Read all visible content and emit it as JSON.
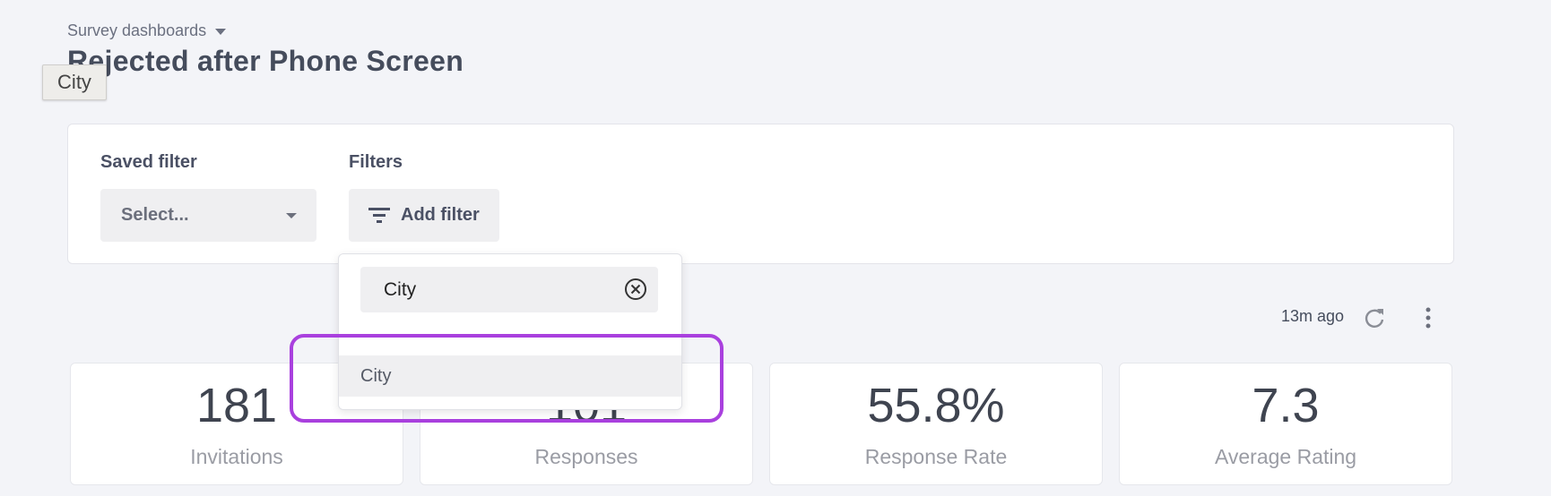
{
  "header": {
    "breadcrumb": "Survey dashboards",
    "title": "Rejected after Phone Screen"
  },
  "tooltip": {
    "text": "City"
  },
  "filters": {
    "saved_filter_label": "Saved filter",
    "saved_filter_value": "Select...",
    "filters_label": "Filters",
    "add_filter_label": "Add filter"
  },
  "dropdown": {
    "search_value": "City",
    "options": [
      {
        "label": "City"
      }
    ]
  },
  "status": {
    "updated": "13m ago"
  },
  "metrics": [
    {
      "value": "181",
      "label": "Invitations"
    },
    {
      "value": "101",
      "label": "Responses"
    },
    {
      "value": "55.8%",
      "label": "Response Rate"
    },
    {
      "value": "7.3",
      "label": "Average Rating"
    }
  ],
  "colors": {
    "background": "#f3f4f8",
    "highlight": "#a940de",
    "text_dark": "#454c5c",
    "text_muted": "#9a9ca4"
  }
}
